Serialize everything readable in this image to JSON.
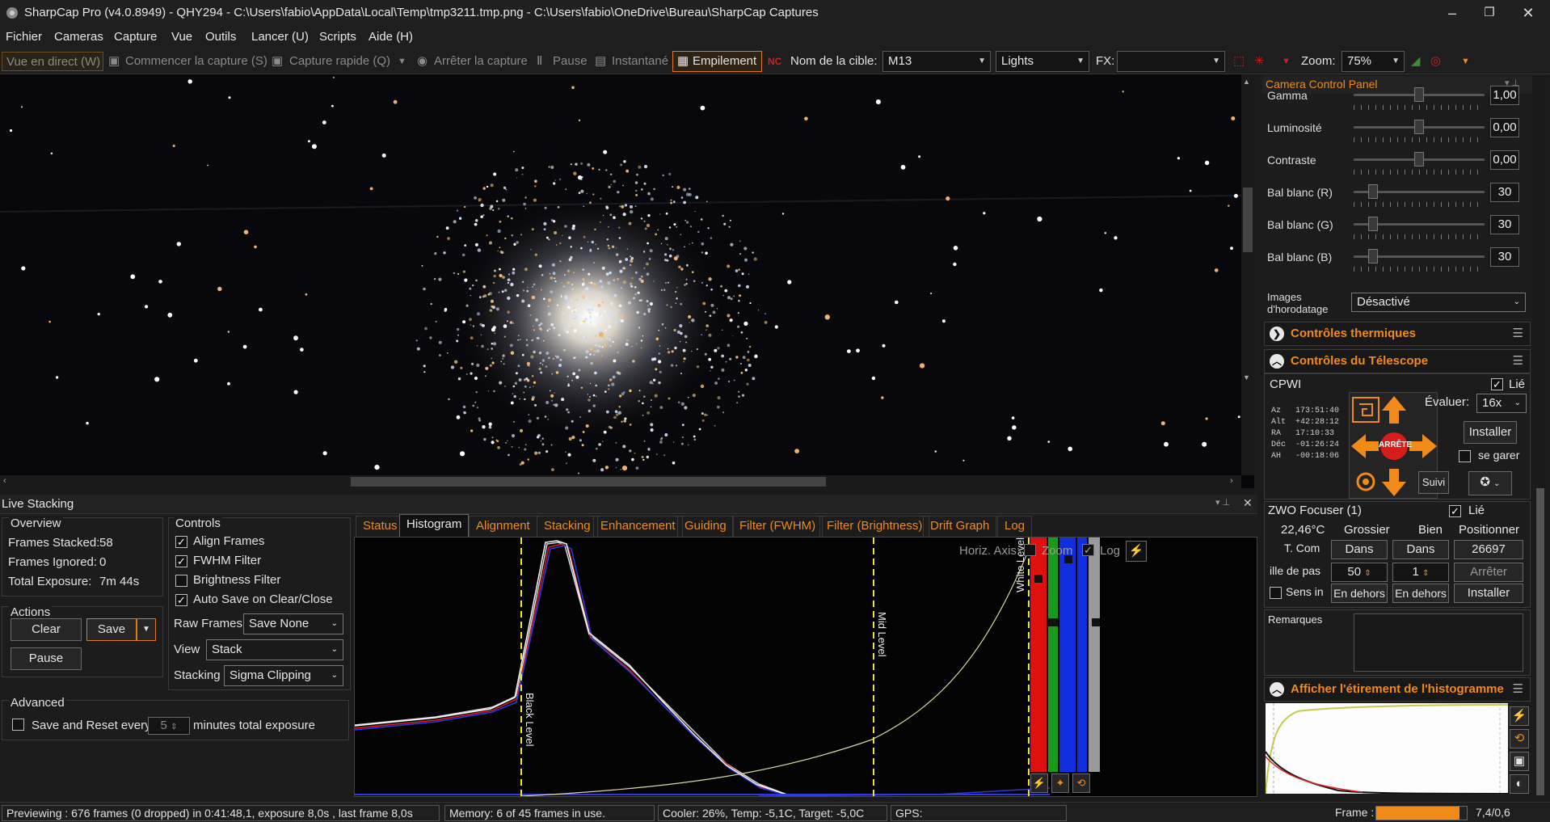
{
  "window": {
    "title": "SharpCap Pro (v4.0.8949) - QHY294 - C:\\Users\\fabio\\AppData\\Local\\Temp\\tmp3211.tmp.png - C:\\Users\\fabio\\OneDrive\\Bureau\\SharpCap Captures"
  },
  "menu": [
    "Fichier",
    "Cameras",
    "Capture",
    "Vue",
    "Outils",
    "Lancer (U)",
    "Scripts",
    "Aide (H)"
  ],
  "toolbar": {
    "live_view": "Vue en direct (W)",
    "start_capture": "Commencer la capture (S)",
    "quick_capture": "Capture rapide (Q)",
    "stop_capture": "Arrêter la capture",
    "pause": "Pause",
    "snapshot": "Instantané",
    "stacking": "Empilement",
    "target_label": "Nom de la cible:",
    "target_value": "M13",
    "frame_type": "Lights",
    "fx_label": "FX:",
    "fx_value": "",
    "zoom_label": "Zoom:",
    "zoom_value": "75%"
  },
  "camera_panel": {
    "title": "Camera Control Panel",
    "rows": [
      {
        "label": "Gamma",
        "value": "1,00",
        "level": 0.5
      },
      {
        "label": "Luminosité",
        "value": "0,00",
        "level": 0.5
      },
      {
        "label": "Contraste",
        "value": "0,00",
        "level": 0.5
      },
      {
        "label": "Bal blanc (R)",
        "value": "30",
        "level": 0.12
      },
      {
        "label": "Bal blanc (G)",
        "value": "30",
        "level": 0.12
      },
      {
        "label": "Bal blanc (B)",
        "value": "30",
        "level": 0.12
      }
    ],
    "timestamp_label_1": "Images",
    "timestamp_label_2": "d'horodatage",
    "timestamp_value": "Désactivé",
    "thermal": "Contrôles thermiques",
    "telescope": "Contrôles du Télescope",
    "mount": "CPWI",
    "linked": "Lié",
    "evaluate_label": "Évaluer:",
    "evaluate_value": "16x",
    "install": "Installer",
    "park": "se garer",
    "stop": "ARRÊTE",
    "track": "Suivi",
    "coords": [
      {
        "k": "Az",
        "v": "173:51:40"
      },
      {
        "k": "Alt",
        "v": "+42:28:12"
      },
      {
        "k": "RA",
        "v": "17:10:33"
      },
      {
        "k": "Déc",
        "v": "-01:26:24"
      },
      {
        "k": "AH",
        "v": "-00:18:06"
      }
    ],
    "focuser": "ZWO Focuser (1)",
    "focuser_linked": "Lié",
    "temp": "22,46°C",
    "coarse": "Grossier",
    "fine": "Bien",
    "position_label": "Positionner",
    "tcomp": "T. Com",
    "in": "Dans",
    "position_value": "26697",
    "step_label": "ille de pas",
    "step_coarse": "50",
    "step_fine": "1",
    "stop_btn": "Arrêter",
    "reverse": "Sens in",
    "out": "En dehors",
    "install2": "Installer",
    "notes": "Remarques",
    "stretch": "Afficher l'étirement de l'histogramme"
  },
  "live_stacking": {
    "title": "Live Stacking",
    "overview": "Overview",
    "frames_stacked_label": "Frames Stacked:",
    "frames_stacked": "58",
    "frames_ignored_label": "Frames Ignored:",
    "frames_ignored": "0",
    "total_exposure_label": "Total Exposure:",
    "total_exposure": "7m 44s",
    "actions": "Actions",
    "clear": "Clear",
    "save": "Save",
    "pause": "Pause",
    "controls": "Controls",
    "align": "Align Frames",
    "fwhm": "FWHM Filter",
    "brightness": "Brightness Filter",
    "autosave": "Auto Save on Clear/Close",
    "raw_label": "Raw Frames",
    "raw_value": "Save None",
    "view_label": "View",
    "view_value": "Stack",
    "stacking_label": "Stacking",
    "stacking_value": "Sigma Clipping",
    "advanced": "Advanced",
    "save_reset": "Save and Reset every",
    "save_reset_value": "5",
    "minutes": "minutes total exposure",
    "tabs": [
      "Status",
      "Histogram",
      "Alignment",
      "Stacking",
      "Enhancement",
      "Guiding",
      "Filter (FWHM)",
      "Filter (Brightness)",
      "Drift Graph",
      "Log"
    ],
    "active_tab": 1,
    "horiz_axis": "Horiz. Axis:",
    "zoom": "Zoom",
    "log": "Log",
    "black_level": "Black Level",
    "mid_level": "Mid Level",
    "white_level": "White Level"
  },
  "status": {
    "preview": "Previewing : 676 frames (0 dropped) in 0:41:48,1, exposure 8,0s , last frame 8,0s",
    "memory": "Memory: 6 of 45 frames in use.",
    "cooler": "Cooler: 26%, Temp: -5,1C, Target: -5,0C",
    "gps": "GPS:",
    "frame_label": "Frame :",
    "frame_value": "7,4/0,6",
    "frame_progress": 0.92
  }
}
